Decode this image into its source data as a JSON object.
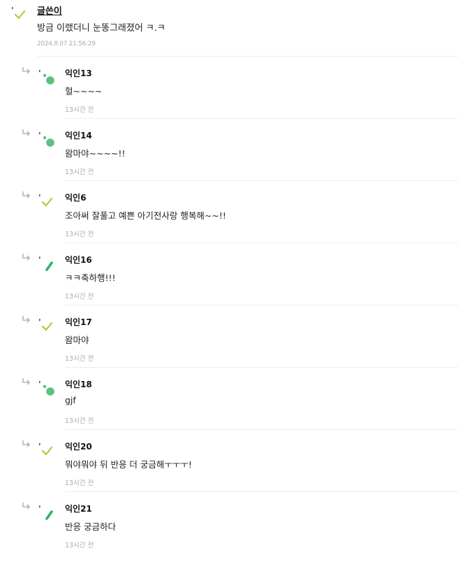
{
  "post_author": {
    "name": "글쓴이",
    "text": "방금 이랬더니 눈똥그래졌어 ㅋ.ㅋ",
    "timestamp": "2024.8.07 21:56:29",
    "avatar": "sprout-leaves-icon"
  },
  "replies": [
    {
      "author": "익인13",
      "text": "헐~~~~",
      "time": "13시간 전",
      "avatar": "circle-avatar-icon"
    },
    {
      "author": "익인14",
      "text": "왐마야~~~~!!",
      "time": "13시간 전",
      "avatar": "circle-avatar-icon"
    },
    {
      "author": "익인6",
      "text": "조아써 잘풀고 예쁜 아기전사랑 행복해~~!!",
      "time": "13시간 전",
      "avatar": "sprout-leaves-icon"
    },
    {
      "author": "익인16",
      "text": "ㅋㅋ축하행!!!",
      "time": "13시간 전",
      "avatar": "leaf-bar-icon"
    },
    {
      "author": "익인17",
      "text": "왐마야",
      "time": "13시간 전",
      "avatar": "sprout-leaves-icon"
    },
    {
      "author": "익인18",
      "text": "gjf",
      "time": "13시간 전",
      "avatar": "circle-avatar-icon"
    },
    {
      "author": "익인20",
      "text": "뭐야뭐야 뒤 반응 더 궁금해ㅜㅜㅜ!",
      "time": "13시간 전",
      "avatar": "sprout-leaves-icon"
    },
    {
      "author": "익인21",
      "text": "반응 궁금하다",
      "time": "13시간 전",
      "avatar": "leaf-bar-icon"
    }
  ],
  "colors": {
    "accent_green": "#5cc17f",
    "leaf_lime": "#a6cf3a",
    "bar_green": "#27b46a",
    "timestamp_gray": "#aaaaaa",
    "divider": "#ececec"
  }
}
